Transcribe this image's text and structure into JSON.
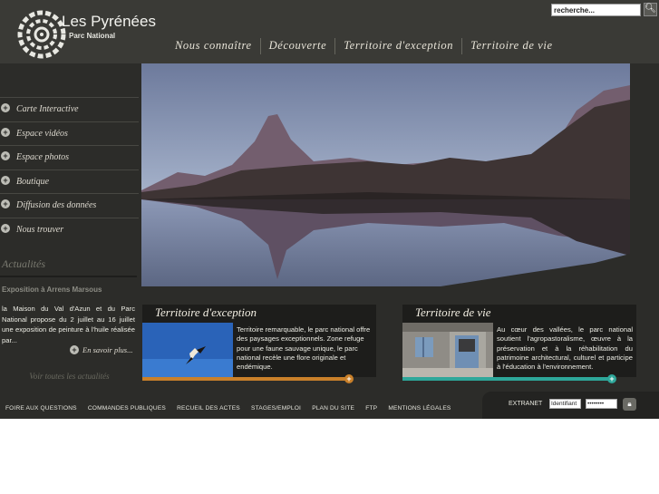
{
  "header": {
    "logo_title": "Les Pyrénées",
    "logo_subtitle": "Parc National",
    "search": {
      "value": "recherche...",
      "button_icon": "search-icon"
    }
  },
  "topnav": [
    {
      "label": "Nous connaître"
    },
    {
      "label": "Découverte"
    },
    {
      "label": "Territoire d'exception"
    },
    {
      "label": "Territoire de vie"
    }
  ],
  "sidebar": {
    "items": [
      {
        "label": "Carte Interactive"
      },
      {
        "label": "Espace vidéos"
      },
      {
        "label": "Espace photos"
      },
      {
        "label": "Boutique"
      },
      {
        "label": "Diffusion des données"
      },
      {
        "label": "Nous trouver"
      }
    ]
  },
  "news": {
    "heading": "Actualités",
    "title": "Exposition à Arrens Marsous",
    "text": "la Maison du Val d'Azun et du Parc National propose du 2 juillet au 16 juillet une exposition de peinture à l'huile réalisée par...",
    "more_label": "En savoir plus...",
    "all_label": "Voir toutes les actualités"
  },
  "panels": {
    "exception": {
      "title": "Territoire d'exception",
      "text": "Territoire remarquable, le parc national offre des paysages exceptionnels. Zone refuge pour une faune sauvage unique, le parc national recèle une flore originale et endémique."
    },
    "vie": {
      "title": "Territoire de vie",
      "text": "Au cœur des vallées, le parc national soutient l'agropastoralisme, œuvre à la préservation et à la réhabilitation du patrimoine architectural, culturel et participe à l'éducation à l'environnement."
    }
  },
  "footer": {
    "links": [
      {
        "label": "FOIRE AUX QUESTIONS"
      },
      {
        "label": "COMMANDES PUBLIQUES"
      },
      {
        "label": "RECUEIL DES ACTES"
      },
      {
        "label": "STAGES/EMPLOI"
      },
      {
        "label": "PLAN DU SITE"
      },
      {
        "label": "FTP"
      },
      {
        "label": "MENTIONS LÉGALES"
      }
    ],
    "extranet": {
      "label": "EXTRANET",
      "login_value": "Identifiant",
      "password_value": "••••••••"
    }
  },
  "colors": {
    "background": "#2c2c29",
    "accent_exception": "#c9802a",
    "accent_vie": "#2ea79a"
  }
}
